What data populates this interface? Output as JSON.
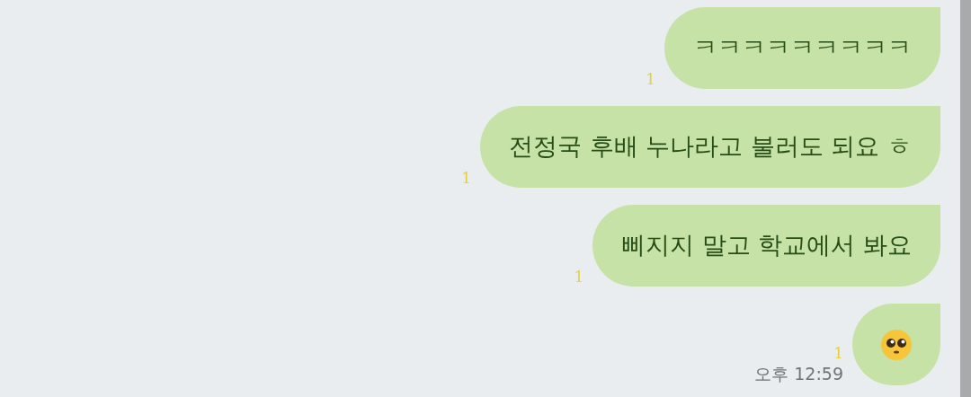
{
  "messages": [
    {
      "kind": "text",
      "text": "ㅋㅋㅋㅋㅋㅋㅋㅋㅋ",
      "read_count": "1"
    },
    {
      "kind": "text",
      "text": "전정국 후배 누나라고 불러도 되요 ㅎ",
      "read_count": "1"
    },
    {
      "kind": "text",
      "text": "삐지지 말고 학교에서 봐요",
      "read_count": "1"
    },
    {
      "kind": "emoji",
      "read_count": "1",
      "time": "오후 12:59"
    }
  ]
}
